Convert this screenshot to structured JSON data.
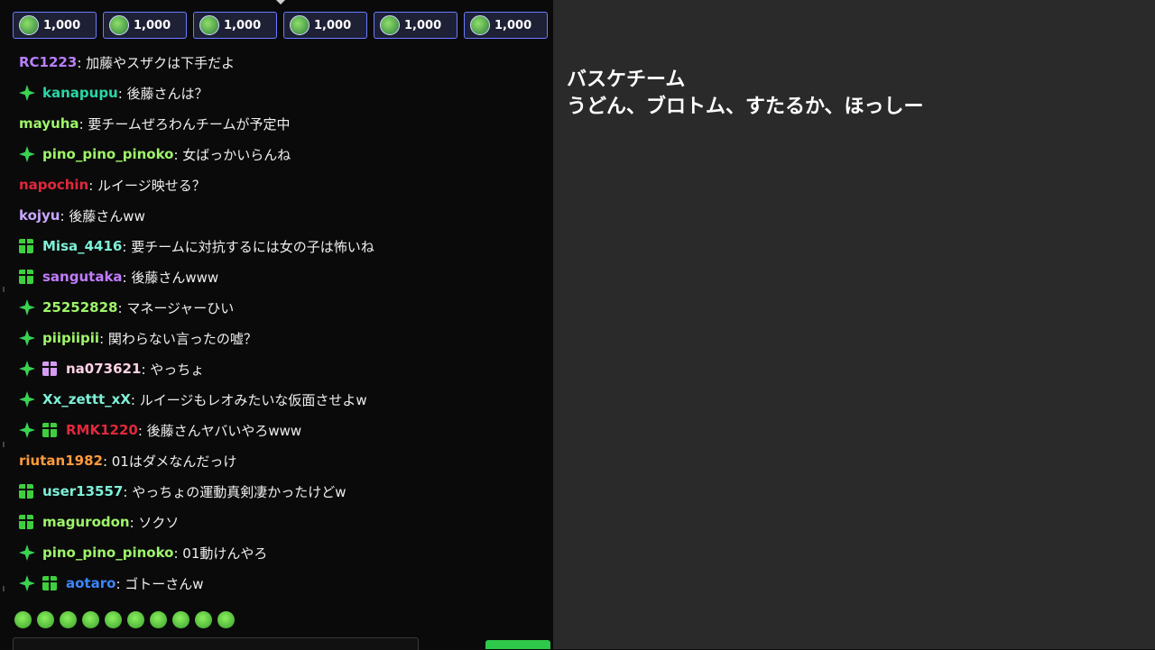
{
  "colors": {
    "spark_badge": "#39d353",
    "gift_badge_green": "#3ecf3e",
    "gift_badge_pink": "#d49cf2",
    "tip_border": "#6a7cff",
    "accent_button": "#2ec84a"
  },
  "tips": [
    {
      "amount": "1,000"
    },
    {
      "amount": "1,000"
    },
    {
      "amount": "1,000"
    },
    {
      "amount": "1,000"
    },
    {
      "amount": "1,000"
    },
    {
      "amount": "1,000"
    }
  ],
  "messages": [
    {
      "badges": [],
      "user": "RC1223",
      "color": "#b980ff",
      "text": ": 加藤やスザクは下手だよ"
    },
    {
      "badges": [
        "spark"
      ],
      "user": "kanapupu",
      "color": "#2ad6a6",
      "text": ": 後藤さんは？"
    },
    {
      "badges": [],
      "user": "mayuha",
      "color": "#9ef56a",
      "text": ": 要チームぜろわんチームが予定中"
    },
    {
      "badges": [
        "spark"
      ],
      "user": "pino_pino_pinoko",
      "color": "#9ef56a",
      "text": ": 女ばっかいらんね"
    },
    {
      "badges": [],
      "user": "napochin",
      "color": "#e0283c",
      "text": ": ルイージ映せる？"
    },
    {
      "badges": [],
      "user": "kojyu",
      "color": "#c8a8ff",
      "text": ": 後藤さんww"
    },
    {
      "badges": [
        "gift"
      ],
      "user": "Misa_4416",
      "color": "#7ef0d8",
      "text": ": 要チームに対抗するには女の子は怖いね"
    },
    {
      "badges": [
        "gift"
      ],
      "user": "sangutaka",
      "color": "#c07cff",
      "text": ": 後藤さんwww"
    },
    {
      "badges": [
        "spark"
      ],
      "user": "25252828",
      "color": "#9ef56a",
      "text": ": マネージャーひい"
    },
    {
      "badges": [
        "spark"
      ],
      "user": "piipiipii",
      "color": "#9ef56a",
      "text": ": 関わらない言ったの嘘？"
    },
    {
      "badges": [
        "spark",
        "gift-pink"
      ],
      "user": "na073621",
      "color": "#ffd2e6",
      "text": ": やっちょ"
    },
    {
      "badges": [
        "spark"
      ],
      "user": "Xx_zettt_xX",
      "color": "#7ef0d8",
      "text": ": ルイージもレオみたいな仮面させよw"
    },
    {
      "badges": [
        "spark",
        "gift"
      ],
      "user": "RMK1220",
      "color": "#e0283c",
      "text": ": 後藤さんヤバいやろwww"
    },
    {
      "badges": [],
      "user": "riutan1982",
      "color": "#ff9a3c",
      "text": ": 01はダメなんだっけ"
    },
    {
      "badges": [
        "gift"
      ],
      "user": "user13557",
      "color": "#7ef0d8",
      "text": ": やっちょの運動真剣凄かったけどw"
    },
    {
      "badges": [
        "gift"
      ],
      "user": "magurodon",
      "color": "#9ef56a",
      "text": ": ソクソ"
    },
    {
      "badges": [
        "spark"
      ],
      "user": "pino_pino_pinoko",
      "color": "#9ef56a",
      "text": ": 01動けんやろ"
    },
    {
      "badges": [
        "spark",
        "gift"
      ],
      "user": "aotaro",
      "color": "#3a86ff",
      "text": ": ゴトーさんw"
    }
  ],
  "emotes": [
    "frog-emote",
    "frog-emote",
    "panda-emote",
    "frog-emote",
    "ghost-emote",
    "frog-emote",
    "frog-emote",
    "frog-emote",
    "frog-emote",
    "frog-emote"
  ],
  "overlay": {
    "title": "バスケチーム",
    "members": "うどん、ブロトム、すたるか、ほっしー"
  }
}
